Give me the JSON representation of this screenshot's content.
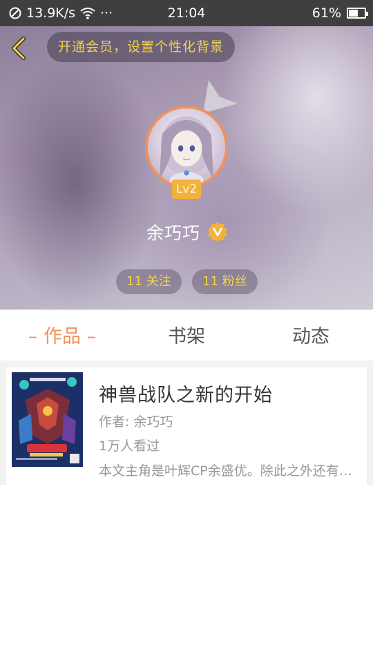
{
  "status_bar": {
    "speed": "13.9K/s",
    "more": "···",
    "time": "21:04",
    "battery_percent": "61%",
    "battery_level": 0.61
  },
  "header": {
    "vip_prompt": "开通会员，设置个性化背景",
    "level": "Lv2",
    "username": "余巧巧",
    "stats": {
      "following": "11 关注",
      "fans": "11 粉丝"
    },
    "colors": {
      "vip_text": "#f2d34a",
      "avatar_border": "#f0915e",
      "level_badge": "#f2b23c"
    }
  },
  "tabs": [
    {
      "label": "– 作品 –",
      "active": true
    },
    {
      "label": "书架",
      "active": false
    },
    {
      "label": "动态",
      "active": false
    }
  ],
  "accent_color": "#f0915e",
  "works": [
    {
      "title": "神兽战队之新的开始",
      "author": "作者: 余巧巧",
      "views": "1万人看过",
      "description": "本文主角是叶辉CP余盛优。除此之外还有其他角色登场"
    }
  ]
}
